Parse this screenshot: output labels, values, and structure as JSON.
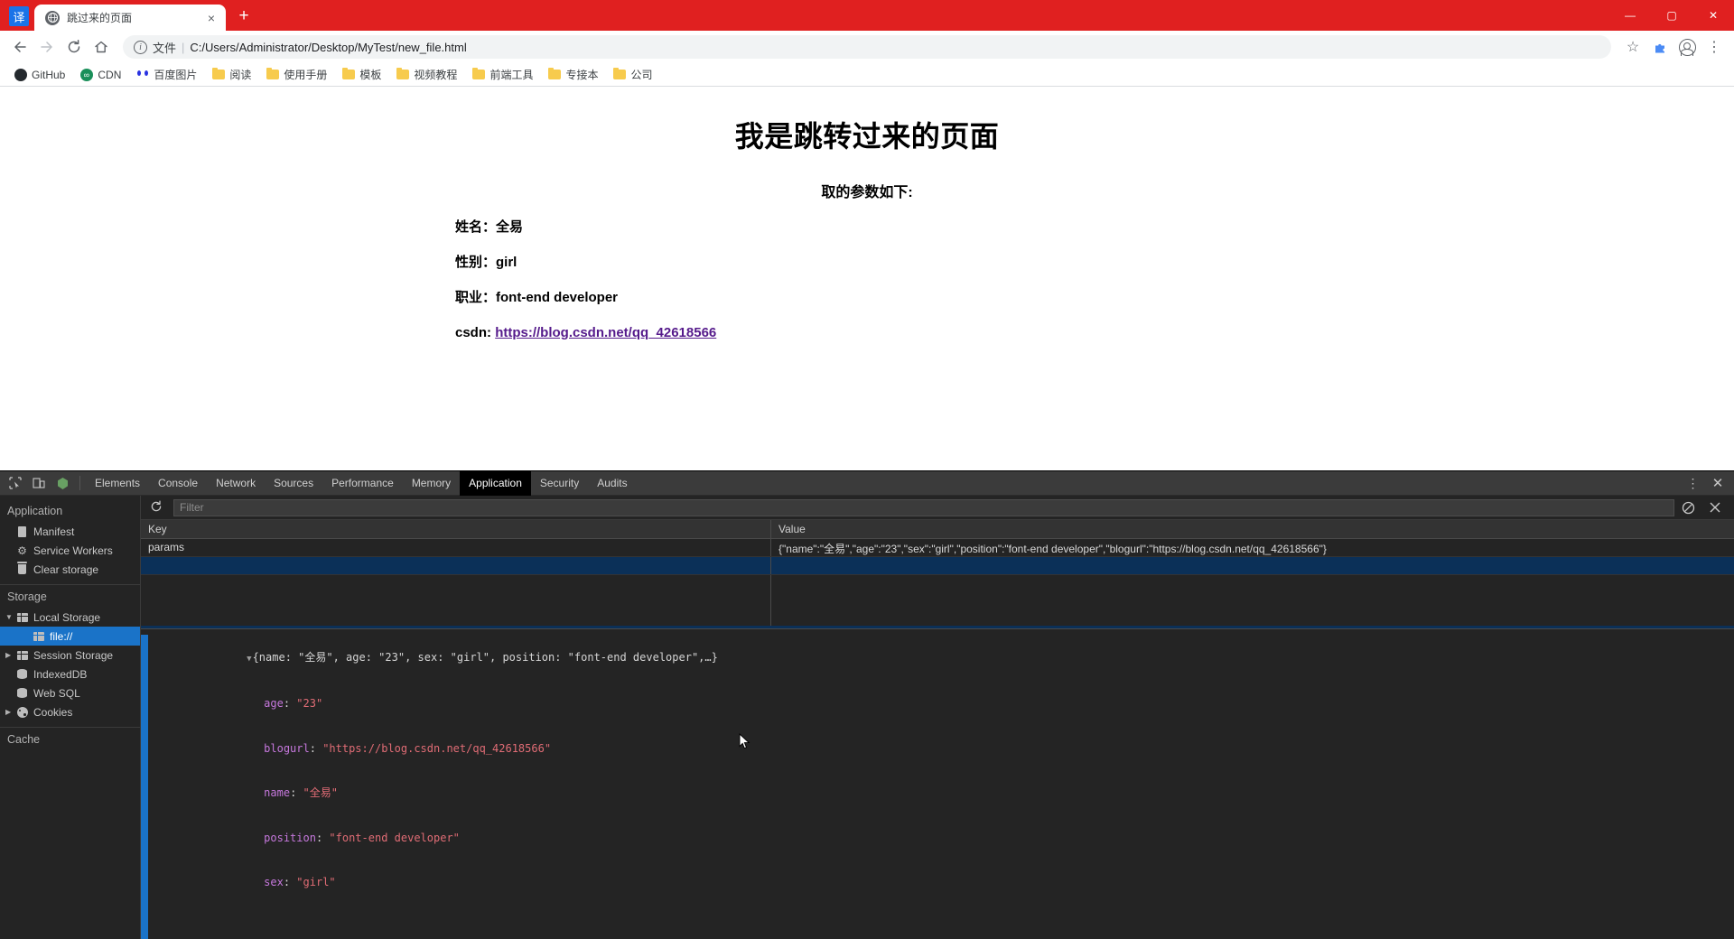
{
  "browser": {
    "translate_badge": "译",
    "tab": {
      "title": "跳过来的页面",
      "favicon": "globe-icon",
      "close": "×"
    },
    "new_tab": "+",
    "window_controls": {
      "minimize": "—",
      "maximize": "▢",
      "close": "✕"
    },
    "nav": {
      "back": "←",
      "forward": "→",
      "reload": "↻",
      "home": "⌂"
    },
    "omnibox": {
      "scheme_label": "文件",
      "separator": "|",
      "url": "C:/Users/Administrator/Desktop/MyTest/new_file.html",
      "star": "☆",
      "extension": "extension-icon",
      "profile": "avatar-icon",
      "menu": "⋮"
    },
    "bookmarks": [
      {
        "label": "GitHub",
        "icon": "github-icon"
      },
      {
        "label": "CDN",
        "icon": "cdn-icon"
      },
      {
        "label": "百度图片",
        "icon": "baidu-icon"
      },
      {
        "label": "阅读",
        "icon": "folder-icon"
      },
      {
        "label": "使用手册",
        "icon": "folder-icon"
      },
      {
        "label": "模板",
        "icon": "folder-icon"
      },
      {
        "label": "视频教程",
        "icon": "folder-icon"
      },
      {
        "label": "前端工具",
        "icon": "folder-icon"
      },
      {
        "label": "专接本",
        "icon": "folder-icon"
      },
      {
        "label": "公司",
        "icon": "folder-icon"
      }
    ]
  },
  "page": {
    "heading": "我是跳转过来的页面",
    "subheading": "取的参数如下:",
    "params": [
      {
        "label": "姓名：",
        "value": "全易",
        "is_link": false
      },
      {
        "label": "性别：",
        "value": "girl",
        "is_link": false
      },
      {
        "label": "职业：",
        "value": "font-end developer",
        "is_link": false
      },
      {
        "label": "csdn:",
        "value": "https://blog.csdn.net/qq_42618566",
        "is_link": true
      }
    ]
  },
  "devtools": {
    "inspect_icon": "inspect-element-icon",
    "device_icon": "device-toolbar-icon",
    "shield_icon": "node-shield-icon",
    "tabs": [
      {
        "label": "Elements",
        "active": false
      },
      {
        "label": "Console",
        "active": false
      },
      {
        "label": "Network",
        "active": false
      },
      {
        "label": "Sources",
        "active": false
      },
      {
        "label": "Performance",
        "active": false
      },
      {
        "label": "Memory",
        "active": false
      },
      {
        "label": "Application",
        "active": true
      },
      {
        "label": "Security",
        "active": false
      },
      {
        "label": "Audits",
        "active": false
      }
    ],
    "more_menu": "⋮",
    "close": "✕",
    "sidebar": {
      "section_application": "Application",
      "application_items": [
        {
          "label": "Manifest",
          "icon": "document-icon"
        },
        {
          "label": "Service Workers",
          "icon": "gear-icon"
        },
        {
          "label": "Clear storage",
          "icon": "trash-icon"
        }
      ],
      "section_storage": "Storage",
      "storage_items": [
        {
          "label": "Local Storage",
          "icon": "table-icon",
          "arrow": "▼",
          "selected": false,
          "indent": 1
        },
        {
          "label": "file://",
          "icon": "table-icon",
          "arrow": "",
          "selected": true,
          "indent": 2
        },
        {
          "label": "Session Storage",
          "icon": "table-icon",
          "arrow": "▶",
          "selected": false,
          "indent": 1
        },
        {
          "label": "IndexedDB",
          "icon": "database-icon",
          "arrow": "",
          "selected": false,
          "indent": 1
        },
        {
          "label": "Web SQL",
          "icon": "database-icon",
          "arrow": "",
          "selected": false,
          "indent": 1
        },
        {
          "label": "Cookies",
          "icon": "cookie-icon",
          "arrow": "▶",
          "selected": false,
          "indent": 1
        }
      ],
      "section_cache": "Cache"
    },
    "toolbar": {
      "refresh": "refresh-icon",
      "filter_placeholder": "Filter",
      "filter_value": "",
      "clear_icon": "clear-filter-icon",
      "delete_icon": "delete-entry-icon"
    },
    "table": {
      "columns": [
        "Key",
        "Value"
      ],
      "rows": [
        {
          "key": "params",
          "value": "{\"name\":\"全易\",\"age\":\"23\",\"sex\":\"girl\",\"position\":\"font-end developer\",\"blogurl\":\"https://blog.csdn.net/qq_42618566\"}"
        }
      ]
    },
    "preview": {
      "summary_prefix": "{",
      "summary": "{name: \"全易\", age: \"23\", sex: \"girl\", position: \"font-end developer\",…}",
      "triangle": "▼",
      "properties": [
        {
          "name": "age",
          "value": "\"23\""
        },
        {
          "name": "blogurl",
          "value": "\"https://blog.csdn.net/qq_42618566\""
        },
        {
          "name": "name",
          "value": "\"全易\""
        },
        {
          "name": "position",
          "value": "\"font-end developer\""
        },
        {
          "name": "sex",
          "value": "\"girl\""
        }
      ]
    }
  },
  "colors": {
    "chrome_red": "#e02020",
    "devtools_bg": "#242424",
    "selection_blue": "#1a73c8",
    "link_purple": "#551a8b",
    "string_red": "#e06c75",
    "property_purple": "#c678dd"
  }
}
